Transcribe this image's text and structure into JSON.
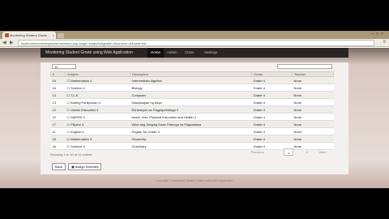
{
  "browser": {
    "tab_title": "Monitoring Student Grade...",
    "url": "localhost/monitoring/students/index.php?page=subjects&grade=4&section=A&view=list"
  },
  "app": {
    "brand": "Monitoring Student Grade using Web Application",
    "nav": [
      "Home",
      "Admin",
      "Class",
      "Settings"
    ]
  },
  "table": {
    "length_label": "10",
    "search_placeholder": "",
    "headers": [
      "#",
      "Subject",
      "Description",
      "Grade",
      "Teacher"
    ],
    "rows": [
      [
        "15",
        "Mathematics 4",
        "Intermediate Algebra",
        "Grade 4",
        "None"
      ],
      [
        "16",
        "Science 4",
        "Biology",
        "Grade 4",
        "None"
      ],
      [
        "14",
        "T.L.E.",
        "Computer",
        "Grade 4",
        "None"
      ],
      [
        "13",
        "Araling Panlipunan 4",
        "Kasaysayan ng Asya",
        "Grade 4",
        "None"
      ],
      [
        "12",
        "Values Education 4",
        "Edukasyon sa Pagpapahalaga 4",
        "Grade 4",
        "None"
      ],
      [
        "10",
        "MAPEH 4",
        "Music, Arts, Physical Education and Health 4",
        "Grade 4",
        "None"
      ],
      [
        "17",
        "Filipino 4",
        "Wika ang Tanging Daan Patungo sa Pagkakaisa",
        "Grade 4",
        "None"
      ],
      [
        "11",
        "English 4",
        "English for Grade 4",
        "Grade 4",
        "None"
      ],
      [
        "15",
        "Mathematics 3",
        "Geometry",
        "Grade 4",
        "None"
      ],
      [
        "16",
        "Science 3",
        "Chemistry",
        "Grade 4",
        "None"
      ]
    ],
    "info": "Showing 1 to 10 of 11 entries",
    "pager": [
      "Previous",
      "1",
      "2",
      "Next"
    ]
  },
  "buttons": {
    "back": "Back",
    "assign": "Assign Selected"
  },
  "footer": "Copyright © Monitoring Student Grade using Web Application"
}
